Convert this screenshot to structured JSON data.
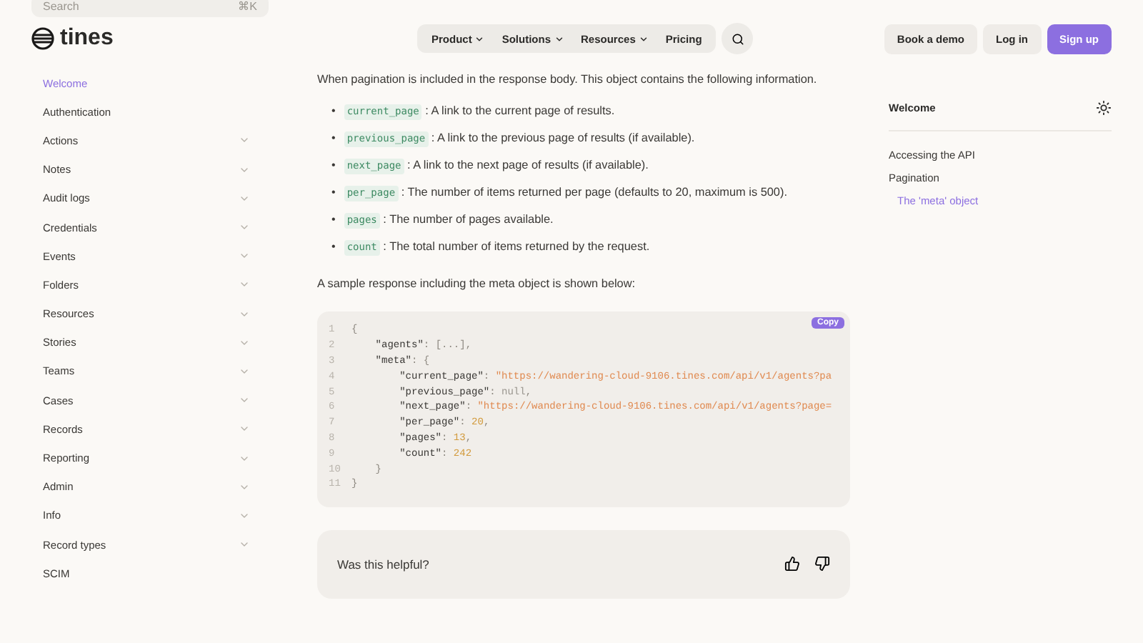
{
  "search": {
    "placeholder": "Search",
    "shortcut": "⌘K"
  },
  "header": {
    "logo": "tines",
    "nav": [
      {
        "label": "Product",
        "kind": "menu"
      },
      {
        "label": "Solutions",
        "kind": "menu"
      },
      {
        "label": "Resources",
        "kind": "menu"
      },
      {
        "label": "Pricing",
        "kind": "link"
      }
    ],
    "buttons": [
      {
        "label": "Book a demo",
        "kind": "secondary"
      },
      {
        "label": "Log in",
        "kind": "secondary"
      },
      {
        "label": "Sign up",
        "kind": "primary"
      }
    ]
  },
  "sidebar": {
    "items": [
      {
        "label": "Welcome",
        "kind": "page",
        "selected": true
      },
      {
        "label": "Authentication",
        "kind": "page",
        "selected": false
      },
      {
        "label": "Actions",
        "kind": "group",
        "selected": false
      },
      {
        "label": "Notes",
        "kind": "group",
        "selected": false
      },
      {
        "label": "Audit logs",
        "kind": "group",
        "selected": false
      },
      {
        "label": "Credentials",
        "kind": "group",
        "selected": false
      },
      {
        "label": "Events",
        "kind": "group",
        "selected": false
      },
      {
        "label": "Folders",
        "kind": "group",
        "selected": false
      },
      {
        "label": "Resources",
        "kind": "group",
        "selected": false
      },
      {
        "label": "Stories",
        "kind": "group",
        "selected": false
      },
      {
        "label": "Teams",
        "kind": "group",
        "selected": false
      },
      {
        "label": "Cases",
        "kind": "group",
        "selected": false
      },
      {
        "label": "Records",
        "kind": "group",
        "selected": false
      },
      {
        "label": "Reporting",
        "kind": "group",
        "selected": false
      },
      {
        "label": "Admin",
        "kind": "group",
        "selected": false
      },
      {
        "label": "Info",
        "kind": "group",
        "selected": false
      },
      {
        "label": "Record types",
        "kind": "group",
        "selected": false
      },
      {
        "label": "SCIM",
        "kind": "page",
        "selected": false
      }
    ]
  },
  "content": {
    "intro": "When pagination is included in the response body. This object contains the following information.",
    "fields": [
      {
        "marker": "•",
        "code": "current_page",
        "text": ": A link to the current page of results."
      },
      {
        "marker": "•",
        "code": "previous_page",
        "text": ": A link to the previous page of results (if available)."
      },
      {
        "marker": "•",
        "code": "next_page",
        "text": ": A link to the next page of results (if available)."
      },
      {
        "marker": "•",
        "code": "per_page",
        "text": ": The number of items returned per page (defaults to 20, maximum is 500)."
      },
      {
        "marker": "•",
        "code": "pages",
        "text": ": The number of pages available."
      },
      {
        "marker": "•",
        "code": "count",
        "text": ": The total number of items returned by the request."
      }
    ],
    "sample_intro": "A sample response including the meta object is shown below:",
    "code_block": {
      "copy_label": "Copy",
      "lines": [
        {
          "number": "1",
          "tokens": [
            {
              "kind": "punct",
              "text": "{"
            }
          ]
        },
        {
          "number": "2",
          "tokens": [
            {
              "kind": "key",
              "text": "    \"agents\""
            },
            {
              "kind": "punct",
              "text": ": [...],"
            }
          ]
        },
        {
          "number": "3",
          "tokens": [
            {
              "kind": "key",
              "text": "    \"meta\""
            },
            {
              "kind": "punct",
              "text": ": {"
            }
          ]
        },
        {
          "number": "4",
          "tokens": [
            {
              "kind": "key",
              "text": "        \"current_page\""
            },
            {
              "kind": "punct",
              "text": ": "
            },
            {
              "kind": "string",
              "text": "\"https://wandering-cloud-9106.tines.com/api/v1/agents?pa"
            }
          ]
        },
        {
          "number": "5",
          "tokens": [
            {
              "kind": "key",
              "text": "        \"previous_page\""
            },
            {
              "kind": "punct",
              "text": ": "
            },
            {
              "kind": "null",
              "text": "null"
            },
            {
              "kind": "punct",
              "text": ","
            }
          ]
        },
        {
          "number": "6",
          "tokens": [
            {
              "kind": "key",
              "text": "        \"next_page\""
            },
            {
              "kind": "punct",
              "text": ": "
            },
            {
              "kind": "string",
              "text": "\"https://wandering-cloud-9106.tines.com/api/v1/agents?page="
            }
          ]
        },
        {
          "number": "7",
          "tokens": [
            {
              "kind": "key",
              "text": "        \"per_page\""
            },
            {
              "kind": "punct",
              "text": ": "
            },
            {
              "kind": "number",
              "text": "20"
            },
            {
              "kind": "punct",
              "text": ","
            }
          ]
        },
        {
          "number": "8",
          "tokens": [
            {
              "kind": "key",
              "text": "        \"pages\""
            },
            {
              "kind": "punct",
              "text": ": "
            },
            {
              "kind": "number",
              "text": "13"
            },
            {
              "kind": "punct",
              "text": ","
            }
          ]
        },
        {
          "number": "9",
          "tokens": [
            {
              "kind": "key",
              "text": "        \"count\""
            },
            {
              "kind": "punct",
              "text": ": "
            },
            {
              "kind": "number",
              "text": "242"
            }
          ]
        },
        {
          "number": "10",
          "tokens": [
            {
              "kind": "punct",
              "text": "    }"
            }
          ]
        },
        {
          "number": "11",
          "tokens": [
            {
              "kind": "punct",
              "text": "}"
            }
          ]
        }
      ]
    },
    "feedback": {
      "question": "Was this helpful?"
    }
  },
  "toc": {
    "title": "Welcome",
    "items": [
      {
        "label": "Accessing the API",
        "selected": false
      },
      {
        "label": "Pagination",
        "selected": false,
        "children": [
          {
            "label": "The 'meta' object",
            "selected": true
          }
        ]
      }
    ]
  }
}
